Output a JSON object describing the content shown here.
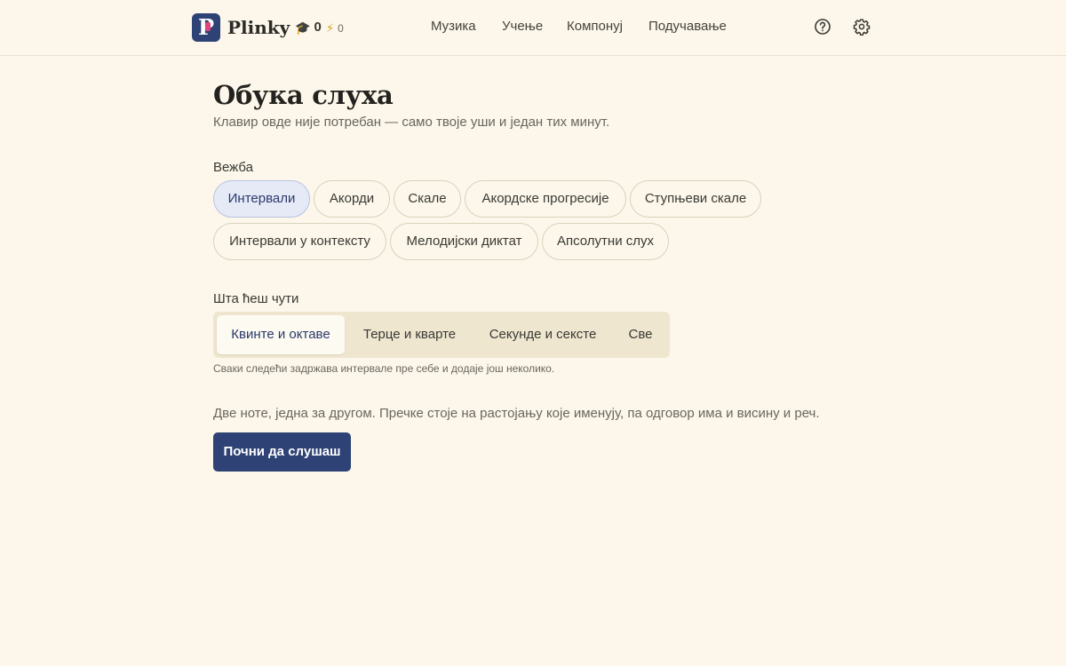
{
  "header": {
    "brand": "Plinky",
    "logo_letter": "P",
    "stats": [
      {
        "icon": "graduation-cap-icon",
        "glyph": "🎓",
        "value": "0"
      },
      {
        "icon": "lightning-icon",
        "glyph": "⚡",
        "value": "0"
      }
    ],
    "nav": [
      "Музика",
      "Учење",
      "Компонуј",
      "Подучавање"
    ],
    "help_icon": "help-circle-icon",
    "settings_icon": "gear-icon"
  },
  "page": {
    "title": "Обука слуха",
    "subtitle": "Клавир овде није потребан — само твоје уши и један тих минут."
  },
  "exercise": {
    "label": "Вежба",
    "options": [
      "Интервали",
      "Акорди",
      "Скале",
      "Акордске прогресије",
      "Ступњеви скале",
      "Интервали у контексту",
      "Мелодијски диктат",
      "Апсолутни слух"
    ],
    "selected": "Интервали"
  },
  "hearing": {
    "label": "Шта ћеш чути",
    "options": [
      "Квинте и октаве",
      "Терце и кварте",
      "Секунде и сексте",
      "Све"
    ],
    "selected": "Квинте и октаве",
    "hint": "Сваки следећи задржава интервале пре себе и додаје још неколико."
  },
  "description": "Две ноте, једна за другом. Пречке стоје на растојању које именују, па одговор има и висину и реч.",
  "start_button": "Почни да слушаш",
  "colors": {
    "background": "#fcf7ea",
    "accent": "#2f4275",
    "logo_dot": "#e0457b",
    "pill_active_bg": "#e6eaf6",
    "segment_bg": "#efe6d0"
  }
}
